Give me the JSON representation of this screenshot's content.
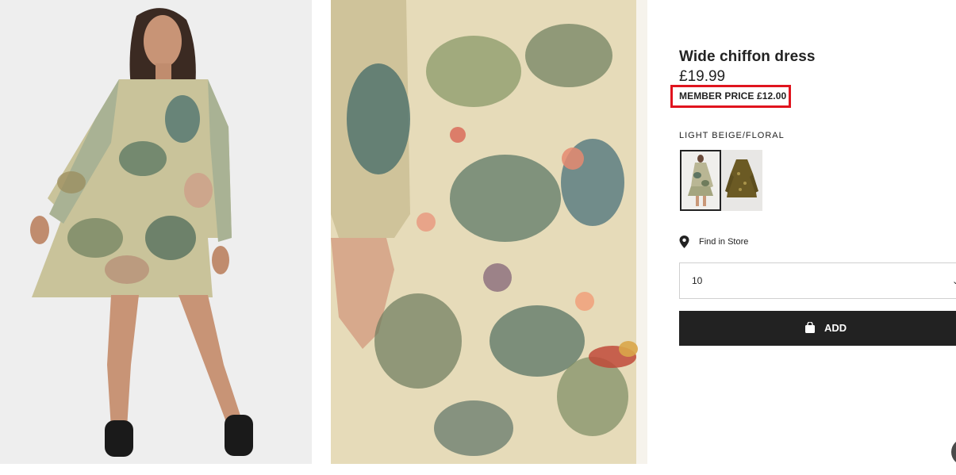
{
  "product": {
    "title": "Wide chiffon dress",
    "price": "£19.99",
    "member_price": "MEMBER PRICE £12.00",
    "highlight_color": "#e0141e"
  },
  "colors": {
    "selected_label": "LIGHT BEIGE/FLORAL",
    "swatches": [
      {
        "name": "light-beige-floral",
        "selected": true
      },
      {
        "name": "dark-khaki-patterned",
        "selected": false
      }
    ]
  },
  "store": {
    "find_label": "Find in Store",
    "icon": "location-pin-icon"
  },
  "size": {
    "selected": "10",
    "icon": "chevron-down-icon"
  },
  "cart": {
    "add_label": "ADD",
    "icon": "shopping-bag-icon",
    "button_color": "#222222"
  },
  "images": {
    "model_photo": "product-photo-model",
    "closeup_photo": "product-photo-closeup"
  }
}
